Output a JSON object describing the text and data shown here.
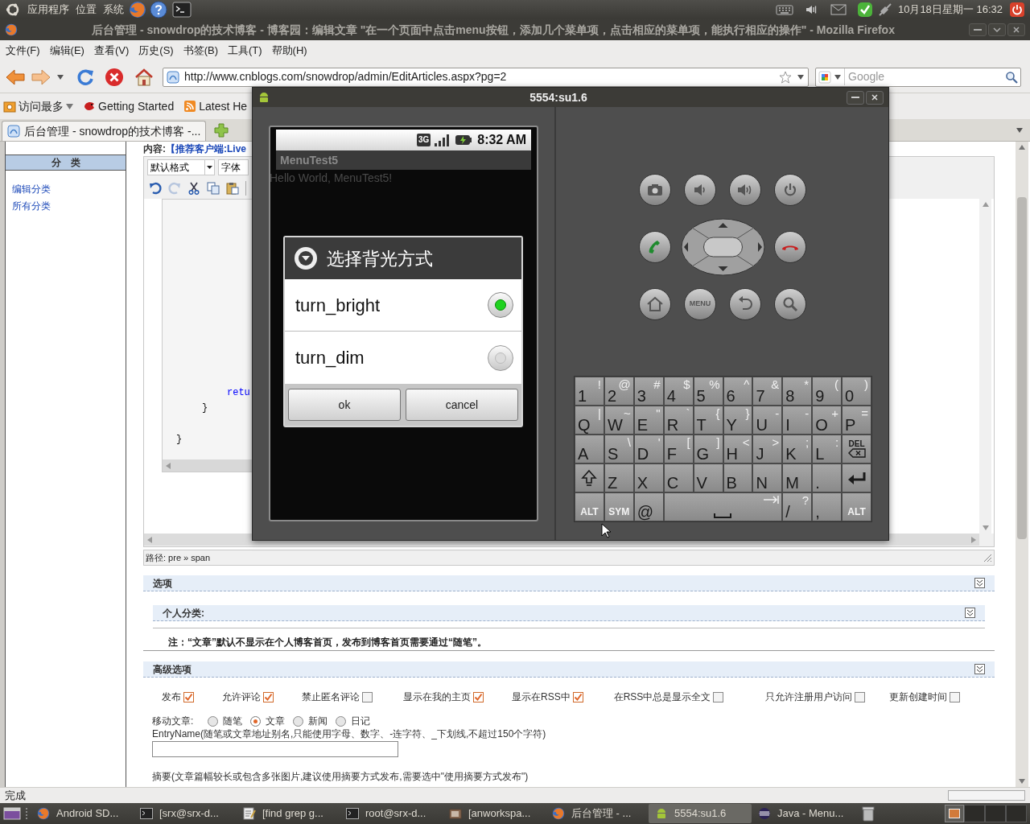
{
  "top_panel": {
    "menus": [
      "应用程序",
      "位置",
      "系统"
    ],
    "clock": "10月18日星期一 16:32"
  },
  "window": {
    "title": "后台管理 - snowdrop的技术博客 - 博客园：编辑文章 \"在一个页面中点击menu按钮，添加几个菜单项，点击相应的菜单项，能执行相应的操作\" - Mozilla Firefox"
  },
  "menu_bar": [
    "文件(F)",
    "编辑(E)",
    "查看(V)",
    "历史(S)",
    "书签(B)",
    "工具(T)",
    "帮助(H)"
  ],
  "navigation": {
    "url": "http://www.cnblogs.com/snowdrop/admin/EditArticles.aspx?pg=2",
    "search": {
      "placeholder": "Google"
    }
  },
  "bookmarks": [
    {
      "label": "访问最多",
      "kind": "folder"
    },
    {
      "label": "Getting Started",
      "kind": "page"
    },
    {
      "label": "Latest He",
      "kind": "feed"
    }
  ],
  "tabs": [
    {
      "label": "后台管理 - snowdrop的技术博客 -...",
      "selected": true
    }
  ],
  "sidebar": {
    "header": "分　类",
    "links": [
      "编辑分类",
      "所有分类"
    ]
  },
  "editor": {
    "label": "内容:",
    "link": "【推荐客户端:Live",
    "format": "默认格式",
    "font": "字体",
    "code_lines": [
      {
        "text": "retu",
        "kind": "keyword"
      },
      {
        "text": "}",
        "kind": "plain"
      },
      {
        "text": "}",
        "kind": "plain"
      }
    ],
    "path": "路径: pre » span"
  },
  "options": {
    "title": "选项",
    "category": "个人分类:",
    "note": "注：“文章”默认不显示在个人博客首页，发布到博客首页需要通过“随笔”。"
  },
  "advanced": {
    "title": "高级选项",
    "checkboxes": [
      {
        "label": "发布",
        "checked": true
      },
      {
        "label": "允许评论",
        "checked": true
      },
      {
        "label": "禁止匿名评论",
        "checked": false
      },
      {
        "label": "显示在我的主页",
        "checked": true
      },
      {
        "label": "显示在RSS中",
        "checked": true
      },
      {
        "label": "在RSS中总是显示全文",
        "checked": false
      },
      {
        "label": "只允许注册用户访问",
        "checked": false
      },
      {
        "label": "更新创建时间",
        "checked": false
      }
    ],
    "move": {
      "label": "移动文章:",
      "options": [
        {
          "label": "随笔",
          "selected": false
        },
        {
          "label": "文章",
          "selected": true
        },
        {
          "label": "新闻",
          "selected": false
        },
        {
          "label": "日记",
          "selected": false
        }
      ]
    },
    "entry_name": "EntryName(随笔或文章地址别名,只能使用字母、数字、-连字符、_下划线,不超过150个字符)",
    "summary": "摘要(文章篇幅较长或包含多张图片,建议使用摘要方式发布,需要选中\"使用摘要方式发布\")"
  },
  "status_bar": "完成",
  "taskbar": [
    {
      "label": "Android SD...",
      "kind": "firefox",
      "selected": false
    },
    {
      "label": "[srx@srx-d...",
      "kind": "terminal",
      "selected": false
    },
    {
      "label": "[find grep g...",
      "kind": "editor",
      "selected": false
    },
    {
      "label": "root@srx-d...",
      "kind": "terminal",
      "selected": false
    },
    {
      "label": "[anworkspa...",
      "kind": "folder",
      "selected": false
    },
    {
      "label": "后台管理 - ...",
      "kind": "firefox",
      "selected": false
    },
    {
      "label": "5554:su1.6",
      "kind": "android",
      "selected": true
    },
    {
      "label": "Java - Menu...",
      "kind": "eclipse",
      "selected": false
    }
  ],
  "emulator": {
    "title": "5554:su1.6",
    "network_type": "3G",
    "time": "8:32 AM",
    "app_title": "MenuTest5",
    "text": "Hello World, MenuTest5!",
    "dialog": {
      "title": "选择背光方式",
      "items": [
        {
          "label": "turn_bright",
          "selected": true
        },
        {
          "label": "turn_dim",
          "selected": false
        }
      ],
      "buttons": [
        "ok",
        "cancel"
      ]
    },
    "menu_key": "MENU",
    "keyboard": [
      [
        {
          "kind": "char",
          "main": "1",
          "alt": "!"
        },
        {
          "kind": "char",
          "main": "2",
          "alt": "@"
        },
        {
          "kind": "char",
          "main": "3",
          "alt": "#"
        },
        {
          "kind": "char",
          "main": "4",
          "alt": "$"
        },
        {
          "kind": "char",
          "main": "5",
          "alt": "%"
        },
        {
          "kind": "char",
          "main": "6",
          "alt": "^"
        },
        {
          "kind": "char",
          "main": "7",
          "alt": "&"
        },
        {
          "kind": "char",
          "main": "8",
          "alt": "*"
        },
        {
          "kind": "char",
          "main": "9",
          "alt": "("
        },
        {
          "kind": "char",
          "main": "0",
          "alt": ")"
        }
      ],
      [
        {
          "kind": "char",
          "main": "Q",
          "alt": "|"
        },
        {
          "kind": "char",
          "main": "W",
          "alt": "~"
        },
        {
          "kind": "char",
          "main": "E",
          "alt": "\""
        },
        {
          "kind": "char",
          "main": "R",
          "alt": "`"
        },
        {
          "kind": "char",
          "main": "T",
          "alt": "{"
        },
        {
          "kind": "char",
          "main": "Y",
          "alt": "}"
        },
        {
          "kind": "char",
          "main": "U",
          "alt": "-"
        },
        {
          "kind": "char",
          "main": "I",
          "alt": "-"
        },
        {
          "kind": "char",
          "main": "O",
          "alt": "+"
        },
        {
          "kind": "char",
          "main": "P",
          "alt": "="
        }
      ],
      [
        {
          "kind": "char",
          "main": "A"
        },
        {
          "kind": "char",
          "main": "S",
          "alt": "\\"
        },
        {
          "kind": "char",
          "main": "D",
          "alt": "'"
        },
        {
          "kind": "char",
          "main": "F",
          "alt": "["
        },
        {
          "kind": "char",
          "main": "G",
          "alt": "]"
        },
        {
          "kind": "char",
          "main": "H",
          "alt": "<"
        },
        {
          "kind": "char",
          "main": "J",
          "alt": ">"
        },
        {
          "kind": "char",
          "main": "K",
          "alt": ";"
        },
        {
          "kind": "char",
          "main": "L",
          "alt": ":"
        },
        {
          "kind": "del",
          "main": "DEL"
        }
      ],
      [
        {
          "kind": "shift"
        },
        {
          "kind": "char",
          "main": "Z"
        },
        {
          "kind": "char",
          "main": "X"
        },
        {
          "kind": "char",
          "main": "C"
        },
        {
          "kind": "char",
          "main": "V"
        },
        {
          "kind": "char",
          "main": "B"
        },
        {
          "kind": "char",
          "main": "N"
        },
        {
          "kind": "char",
          "main": "M"
        },
        {
          "kind": "char",
          "main": "."
        },
        {
          "kind": "enter"
        }
      ],
      [
        {
          "kind": "mod",
          "main": "ALT"
        },
        {
          "kind": "mod",
          "main": "SYM"
        },
        {
          "kind": "char",
          "main": "@"
        },
        {
          "kind": "space"
        },
        {
          "kind": "char",
          "main": "/",
          "alt": "?"
        },
        {
          "kind": "char",
          "main": ","
        },
        {
          "kind": "mod",
          "main": "ALT"
        }
      ]
    ]
  }
}
